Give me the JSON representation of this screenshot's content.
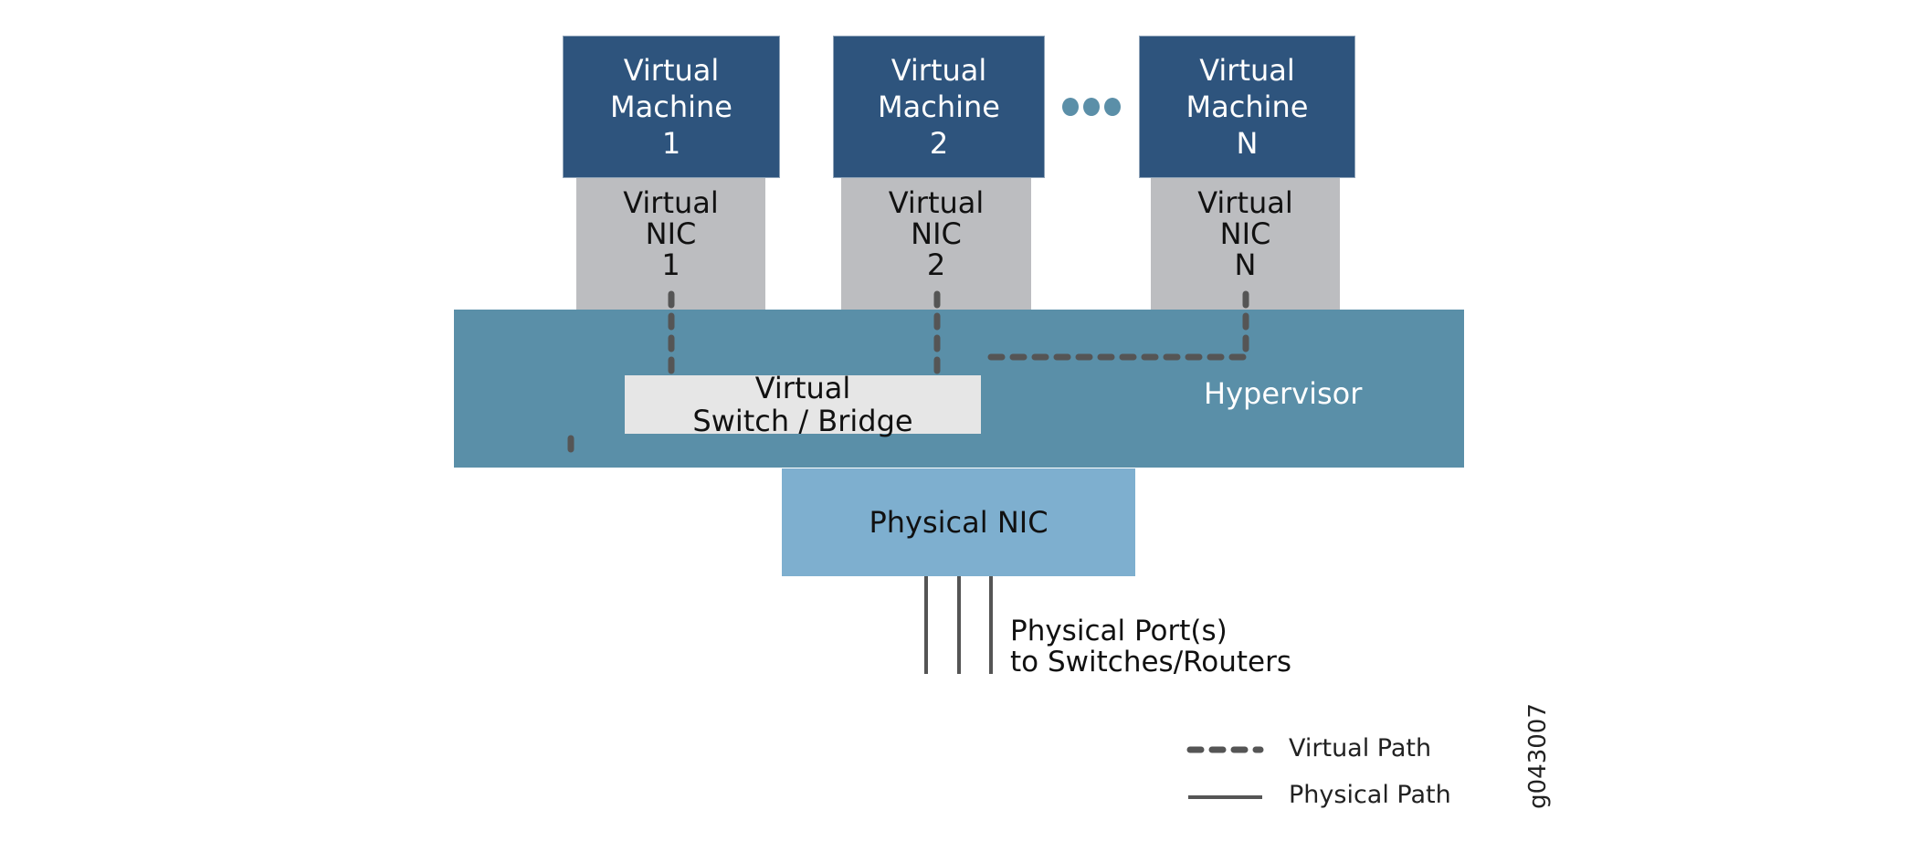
{
  "virtual_machines": [
    {
      "line1": "Virtual",
      "line2": "Machine",
      "line3": "1"
    },
    {
      "line1": "Virtual",
      "line2": "Machine",
      "line3": "2"
    },
    {
      "line1": "Virtual",
      "line2": "Machine",
      "line3": "N"
    }
  ],
  "virtual_nics": [
    {
      "line1": "Virtual",
      "line2": "NIC",
      "line3": "1"
    },
    {
      "line1": "Virtual",
      "line2": "NIC",
      "line3": "2"
    },
    {
      "line1": "Virtual",
      "line2": "NIC",
      "line3": "N"
    }
  ],
  "hypervisor": {
    "label": "Hypervisor"
  },
  "virtual_switch": {
    "line1": "Virtual",
    "line2": "Switch / Bridge"
  },
  "physical_nic": {
    "label": "Physical NIC"
  },
  "physical_ports": {
    "line1": "Physical Port(s)",
    "line2": "to Switches/Routers"
  },
  "legend": {
    "virtual_path": "Virtual Path",
    "physical_path": "Physical Path"
  },
  "figure_id": "g043007",
  "colors": {
    "vm": "#2e547d",
    "nic": "#bcbdc0",
    "hypervisor": "#5a8fa8",
    "switch": "#e6e6e6",
    "physical_nic": "#7eafcf",
    "path": "#555555",
    "ellipsis": "#5b8fa8"
  }
}
